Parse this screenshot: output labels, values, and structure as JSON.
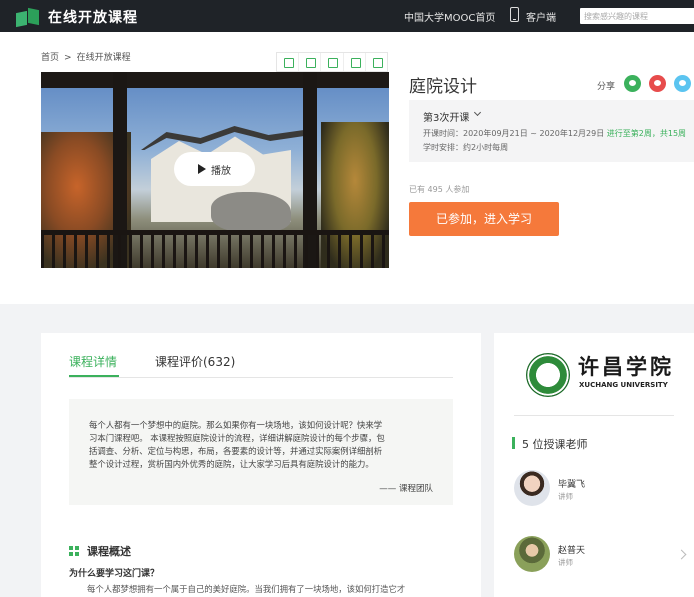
{
  "topbar": {
    "brand": "在线开放课程",
    "mooc_link": "中国大学MOOC首页",
    "client_link": "客户端",
    "search_placeholder": "搜索感兴趣的课程"
  },
  "breadcrumb": {
    "home": "首页",
    "sep": ">",
    "current": "在线开放课程"
  },
  "video": {
    "play_label": "播放"
  },
  "course": {
    "title": "庭院设计",
    "share_label": "分享",
    "term": "第3次开课",
    "time_label": "开课时间：",
    "time_value": "2020年09月21日 ~ 2020年12月29日",
    "progress": "进行至第2周，共15周",
    "workload_label": "学时安排：",
    "workload_value": "约2小时每周",
    "enrolled": "已有 495 人参加",
    "join_button": "已参加，进入学习"
  },
  "tabs": {
    "detail": "课程详情",
    "reviews": "课程评价(632)"
  },
  "intro": {
    "quote_lines": [
      "每个人都有一个梦想中的庭院。那么如果你有一块场地，该如何设计呢？快来学",
      "习本门课程吧。 本课程按照庭院设计的流程，详细讲解庭院设计的每个步骤，包",
      "括调查、分析、定位与构思，布局，各要素的设计等，并通过实际案例详细剖析",
      "整个设计过程，赏析国内外优秀的庭院，让大家学习后具有庭院设计的能力。"
    ],
    "signature": "—— 课程团队",
    "section_title": "课程概述",
    "question": "为什么要学习这门课？",
    "paragraph": "每个人都梦想拥有一个属于自己的美好庭院。当我们拥有了一块场地，该如何打造它才"
  },
  "school": {
    "name_cn": "许昌学院",
    "name_en": "XUCHANG UNIVERSITY"
  },
  "teachers": {
    "title": "5 位授课老师",
    "list": [
      {
        "name": "毕冀飞",
        "role": "讲师"
      },
      {
        "name": "赵普天",
        "role": "讲师"
      }
    ]
  },
  "colors": {
    "accent": "#3bb15c",
    "join": "#f5793b",
    "topbar": "#1f2328"
  }
}
